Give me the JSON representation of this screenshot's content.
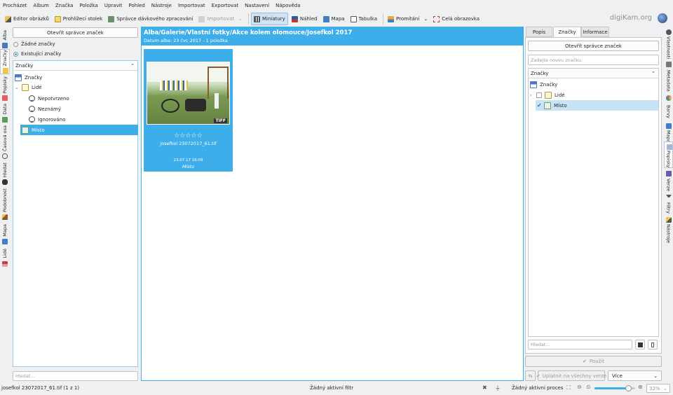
{
  "menu": [
    "Procházet",
    "Album",
    "Značka",
    "Položka",
    "Upravit",
    "Pohled",
    "Nástroje",
    "Importovat",
    "Exportovat",
    "Nastavení",
    "Nápověda"
  ],
  "toolbar": {
    "editor": "Editor obrázků",
    "light_table": "Prohlížecí stolek",
    "batch": "Správce dávkového zpracování",
    "import": "Importovat",
    "thumbnails": "Miniatury",
    "preview": "Náhled",
    "map": "Mapa",
    "table": "Tabulka",
    "slideshow": "Promítání",
    "fullscreen": "Celá obrazovka"
  },
  "brand": "digiKam.org",
  "left_tabs": [
    "Alba",
    "Značky",
    "Popisky",
    "Data",
    "Časová osa",
    "Hledat",
    "Podobnost",
    "Mapa",
    "Lidé"
  ],
  "right_tabs": [
    "Vlastnosti",
    "Metadata",
    "Barvy",
    "Mapa",
    "Popisky",
    "Verze",
    "Filtry",
    "Nástroje"
  ],
  "left_panel": {
    "open_manager": "Otevřít správce značek",
    "radio_none": "Žádné značky",
    "radio_existing": "Existující značky",
    "combo": "Značky",
    "tree": [
      {
        "label": "Značky"
      },
      {
        "label": "Lidé"
      },
      {
        "label": "Nepotvrzeno"
      },
      {
        "label": "Neznámý"
      },
      {
        "label": "Ignorováno"
      },
      {
        "label": "Místo"
      }
    ],
    "search_placeholder": "Hledat..."
  },
  "center": {
    "path": "Alba/Galerie/Vlastní fotky/Akce kolem olomouce/Josefkol 2017",
    "subtitle": "Datum alba: 23 čvc 2017 - 1 položka",
    "item": {
      "badge": "TIFF",
      "stars": "☆☆☆☆☆",
      "filename": "josefkol 23072017_61.tif",
      "date": "23.07.17 16:09",
      "tag": "Místo"
    }
  },
  "right_panel": {
    "tabs": [
      "Popis",
      "Značky",
      "Informace"
    ],
    "open_manager": "Otevřít správce značek",
    "new_tag_placeholder": "Zadejte novou značku.",
    "combo": "Značky",
    "tree": [
      {
        "label": "Značky"
      },
      {
        "label": "Lidé"
      },
      {
        "label": "Místo"
      }
    ],
    "search_placeholder": "Hledat...",
    "apply": "Použít",
    "apply_all": "Uplatnit na všechny verze",
    "more": "Více"
  },
  "status": {
    "file": "josefkol 23072017_61.tif (1 z 1)",
    "filter": "Žádný aktivní filtr",
    "process": "Žádný aktivní proces",
    "zoom": "32%"
  },
  "colors": {
    "accent": "#3daee9",
    "background": "#eff0f1"
  }
}
